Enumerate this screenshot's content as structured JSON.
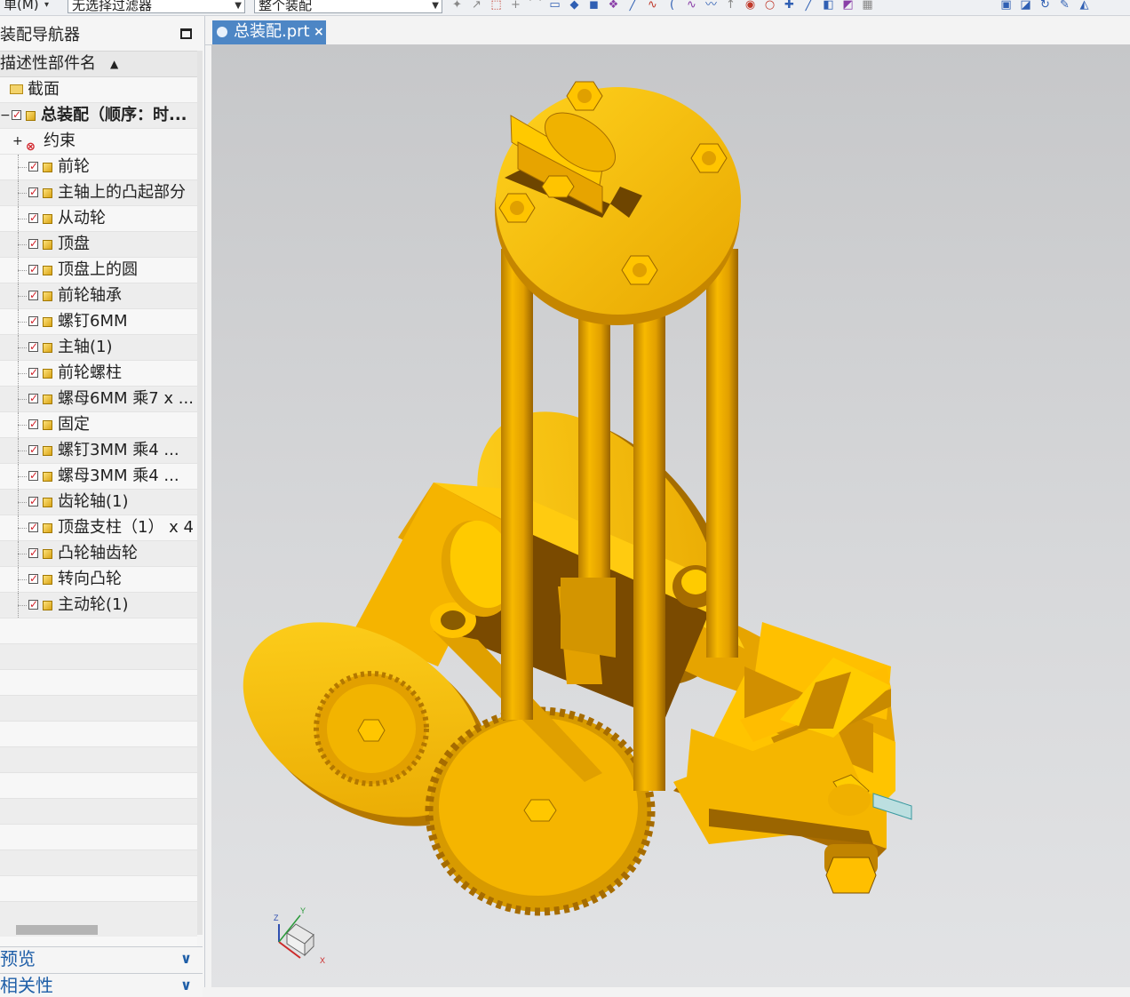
{
  "toolbar": {
    "menu_label": "单(M)",
    "filter_value": "无选择过滤器",
    "scope_value": "整个装配",
    "icons": [
      "snap-point-icon",
      "snap-end-icon",
      "snap-mid-icon",
      "snap-plus-icon",
      "snap-arc-icon",
      "snap-box-icon",
      "select-body-icon",
      "select-face-icon",
      "snap-grid-icon",
      "snap-line-icon",
      "snap-curve-icon",
      "snap-arc2-icon",
      "snap-spline-icon",
      "snap-wave-icon",
      "snap-arrow-icon",
      "snap-center-icon",
      "snap-circle-icon",
      "snap-intersect-icon",
      "snap-tangent-icon",
      "select-solid-icon",
      "select-sheet-icon",
      "select-assembly-icon"
    ],
    "right_icons": [
      "view-fit-icon",
      "view-section-icon",
      "view-rotate-icon",
      "view-pen-icon",
      "view-shade-icon"
    ]
  },
  "navigator": {
    "title": "装配导航器",
    "column_header": "描述性部件名",
    "section_label": "截面",
    "root_label": "总装配（顺序：时...",
    "constraints_label": "约束",
    "parts": [
      "前轮",
      "主轴上的凸起部分",
      "从动轮",
      "顶盘",
      "顶盘上的圆",
      "前轮轴承",
      "螺钉6MM",
      "主轴(1)",
      "前轮螺柱",
      "螺母6MM  乘7 x ...",
      "固定",
      "螺钉3MM    乘4 ...",
      "螺母3MM    乘4 ...",
      "齿轮轴(1)",
      "顶盘支柱（1） x 4",
      "凸轮轴齿轮",
      "转向凸轮",
      "主动轮(1)"
    ],
    "panels": {
      "preview": "预览",
      "dependencies": "相关性"
    }
  },
  "graphics": {
    "tab_label": "总装配.prt",
    "tab_close": "×",
    "axis_labels": {
      "x": "X",
      "y": "Y",
      "z": "Z"
    },
    "part_color": "#f5b800",
    "background_color": "#d4d5d7"
  }
}
